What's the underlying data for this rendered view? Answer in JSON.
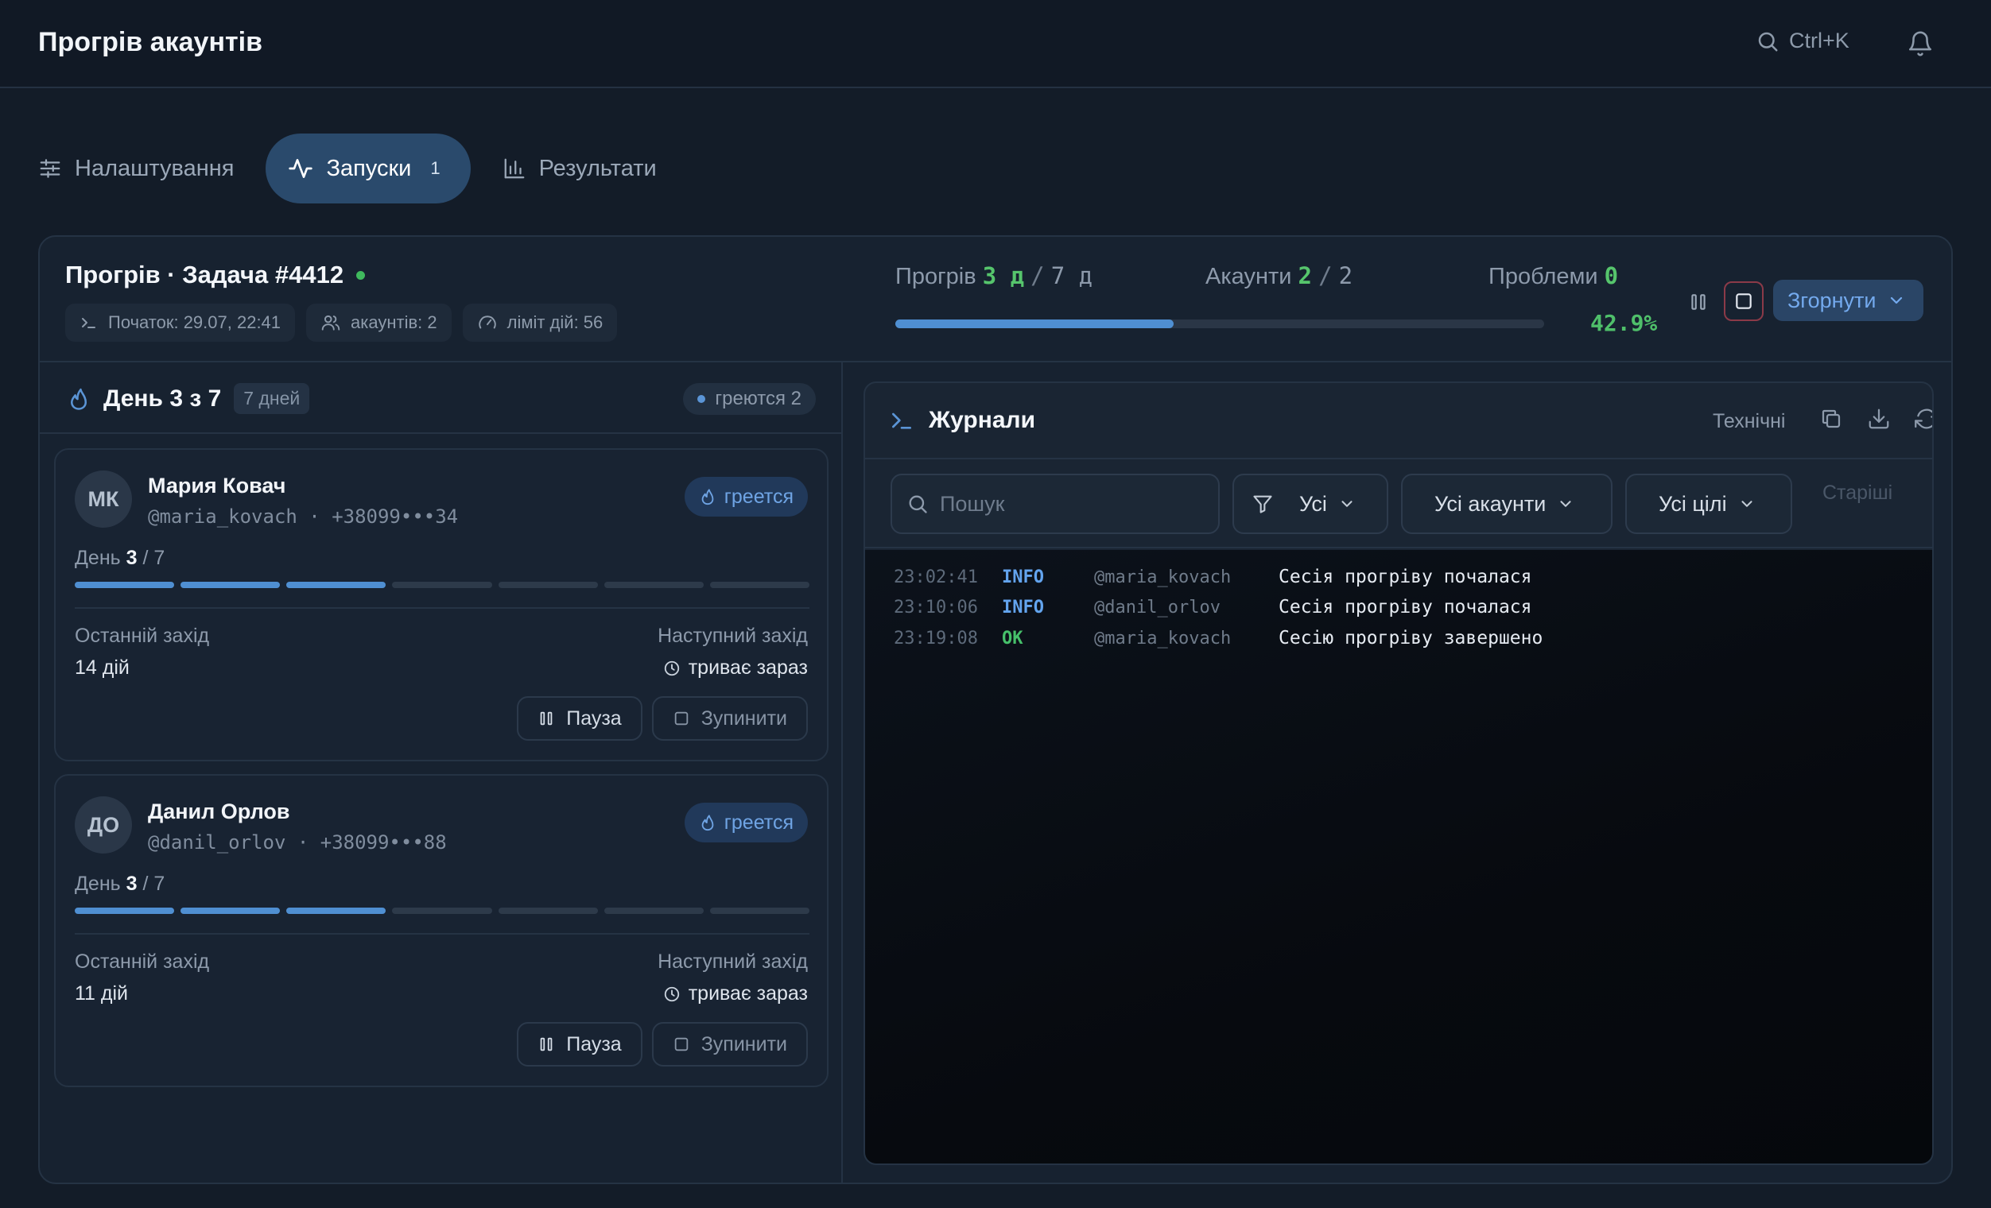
{
  "app": {
    "title": "Прогрів акаунтів",
    "search_shortcut": "Ctrl+K"
  },
  "tabs": [
    {
      "label": "Налаштування",
      "icon": "sliders-icon"
    },
    {
      "label": "Запуски",
      "icon": "activity-icon",
      "count": "1",
      "active": true
    },
    {
      "label": "Результати",
      "icon": "bar-chart-icon"
    }
  ],
  "task": {
    "title": "Прогрів · Задача #4412",
    "chips": [
      "Початок: 29.07, 22:41",
      "акаунтів: 2",
      "ліміт дій: 56"
    ],
    "stats": {
      "warmup_label": "Прогрів",
      "warmup_done": "3 д",
      "warmup_total": "7 д",
      "accounts_label": "Акаунти",
      "accounts_done": "2",
      "accounts_total": "2",
      "problems_label": "Проблеми",
      "problems_count": "0"
    },
    "progress": 0.429,
    "progress_text": "42.9%",
    "collapse_label": "Згорнути"
  },
  "day_panel": {
    "title": "День 3 з 7",
    "badge": "7 дней",
    "warming_pill": "греются 2"
  },
  "accounts": [
    {
      "initials": "МК",
      "name": "Мария Ковач",
      "handle": "@maria_kovach · +38099•••34",
      "status": "греется",
      "day_label": "День",
      "day_current": "3",
      "day_total": "/ 7",
      "segments_done": 3,
      "segments_total": 7,
      "last_label": "Останній захід",
      "last_value": "14 дій",
      "next_label": "Наступний захід",
      "next_value": "триває зараз",
      "pause_label": "Пауза",
      "stop_label": "Зупинити"
    },
    {
      "initials": "ДО",
      "name": "Данил Орлов",
      "handle": "@danil_orlov · +38099•••88",
      "status": "греется",
      "day_label": "День",
      "day_current": "3",
      "day_total": "/ 7",
      "segments_done": 3,
      "segments_total": 7,
      "last_label": "Останній захід",
      "last_value": "11 дій",
      "next_label": "Наступний захід",
      "next_value": "триває зараз",
      "pause_label": "Пауза",
      "stop_label": "Зупинити"
    }
  ],
  "logs": {
    "title": "Журнали",
    "tech_label": "Технічні",
    "search_placeholder": "Пошук",
    "filter_level": "Усі",
    "filter_accounts": "Усі акаунти",
    "filter_targets": "Усі цілі",
    "older_label": "Старіші",
    "entries": [
      {
        "time": "23:02:41",
        "level": "INFO",
        "user": "@maria_kovach",
        "message": "Сесія прогріву почалася"
      },
      {
        "time": "23:10:06",
        "level": "INFO",
        "user": "@danil_orlov",
        "message": "Сесія прогріву почалася"
      },
      {
        "time": "23:19:08",
        "level": "OK",
        "user": "@maria_kovach",
        "message": "Сесію прогріву завершено"
      }
    ]
  },
  "colors": {
    "accent": "#4f8fd2",
    "success": "#46c06a",
    "background": "#131c28"
  }
}
